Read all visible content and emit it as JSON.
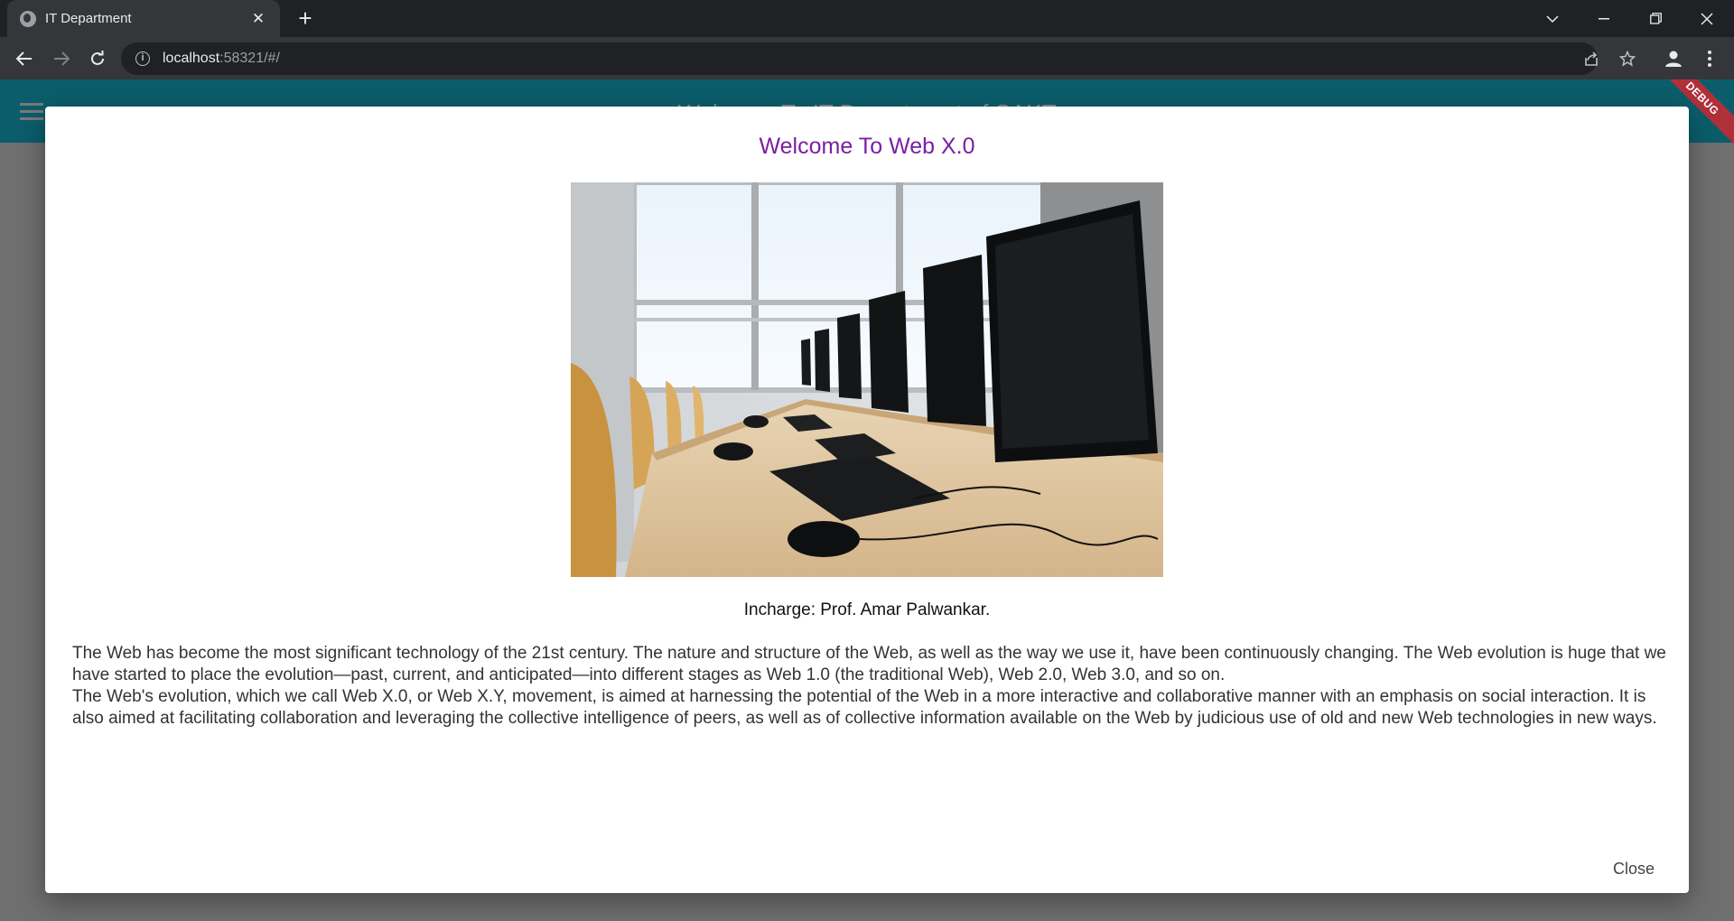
{
  "browser": {
    "tab_title": "IT Department",
    "url_host": "localhost",
    "url_rest": ":58321/#/"
  },
  "app": {
    "title": "Welcome To IT Department of SAKT",
    "debug_label": "DEBUG"
  },
  "dialog": {
    "title": "Welcome To Web X.0",
    "image_alt": "computer-lab-photo",
    "incharge": "Incharge: Prof. Amar Palwankar.",
    "description": "The Web has become the most significant technology of the 21st century. The nature and structure of the Web, as well as the way we use it, have been continuously changing. The Web evolution is huge that we have started to place the evolution—past, current, and anticipated—into different stages as Web 1.0 (the traditional Web), Web 2.0, Web 3.0, and so on.\n The Web's evolution, which we call Web X.0, or Web X.Y, movement, is aimed at harnessing the potential of the Web in a more interactive and collaborative manner with an emphasis on social interaction. It is also aimed at facilitating collaboration and leveraging the collective intelligence of peers, as well as of collective information available on the Web by judicious use of old and new Web technologies in new ways.",
    "close_label": "Close"
  },
  "colors": {
    "dialog_title": "#7b1fa2",
    "app_bar": "#0b5d6b",
    "scrim": "#6f6f6f",
    "debug_banner": "#b0303a"
  }
}
